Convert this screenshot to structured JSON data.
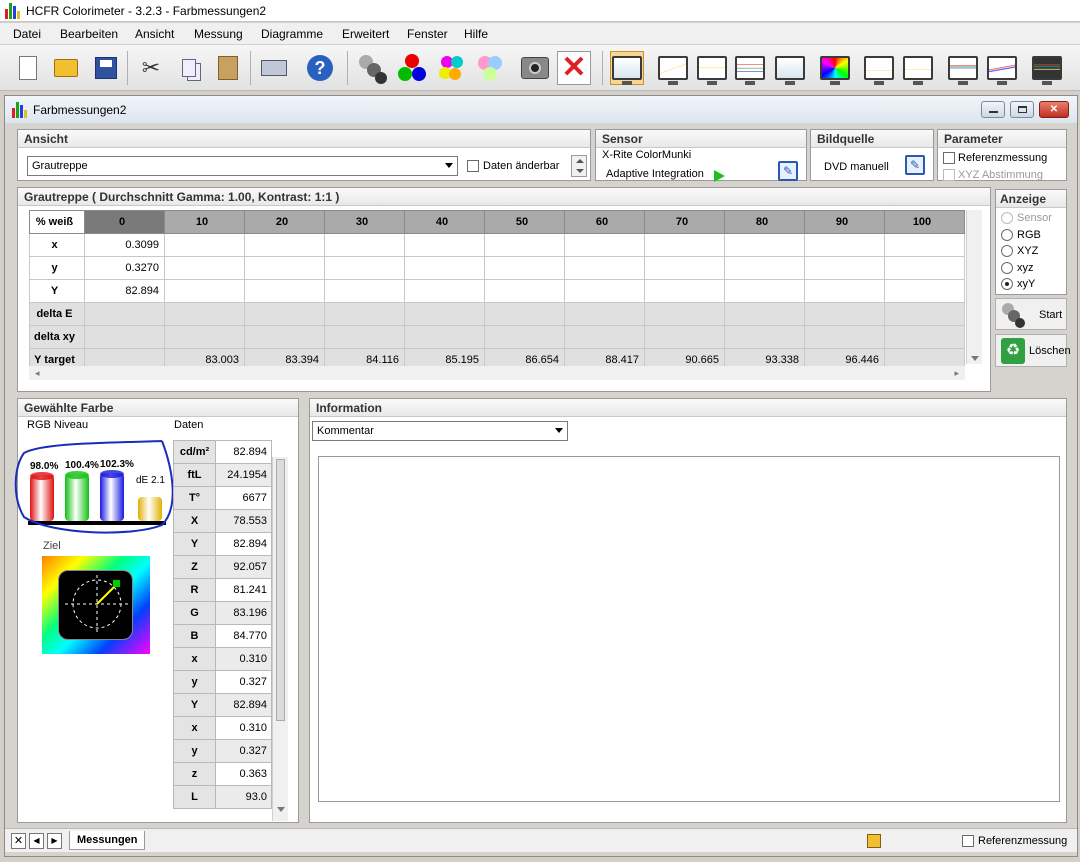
{
  "app": {
    "title": "HCFR Colorimeter - 3.2.3 - Farbmessungen2"
  },
  "menu": [
    "Datei",
    "Bearbeiten",
    "Ansicht",
    "Messung",
    "Diagramme",
    "Erweitert",
    "Fenster",
    "Hilfe"
  ],
  "toolbar_icons": [
    "new-document-icon",
    "open-folder-icon",
    "save-icon",
    "cut-icon",
    "copy-icon",
    "paste-icon",
    "print-icon",
    "help-icon",
    "gray-balls-icon",
    "rgb-balls-icon",
    "colored-balls-icon",
    "pastel-balls-icon",
    "camera-icon",
    "delete-x-icon",
    "monitor-view-icon",
    "gamma-chart-icon",
    "luminance-chart-icon",
    "rgb-levels-chart-icon",
    "white-chart-icon",
    "cie-chart-icon",
    "ntsc-chart-icon",
    "colortemp-chart-icon",
    "rgb-histo-chart-icon",
    "near-black-chart-icon",
    "near-white-chart-icon"
  ],
  "doc": {
    "title": "Farbmessungen2"
  },
  "ansicht": {
    "title": "Ansicht",
    "combo_value": "Grautreppe",
    "checkbox_label": "Daten änderbar"
  },
  "sensor": {
    "title": "Sensor",
    "name": "X-Rite ColorMunki",
    "mode": "Adaptive Integration"
  },
  "bildquelle": {
    "title": "Bildquelle",
    "value": "DVD manuell"
  },
  "parameter": {
    "title": "Parameter",
    "ref": "Referenzmessung",
    "xyz": "XYZ Abstimmung"
  },
  "grid": {
    "title": "Grautreppe ( Durchschnitt Gamma: 1.00, Kontrast: 1:1 )",
    "corner": "% weiß",
    "columns": [
      "0",
      "10",
      "20",
      "30",
      "40",
      "50",
      "60",
      "70",
      "80",
      "90",
      "100"
    ],
    "rows": [
      {
        "label": "x",
        "values": [
          "0.3099",
          "",
          "",
          "",
          "",
          "",
          "",
          "",
          "",
          "",
          ""
        ]
      },
      {
        "label": "y",
        "values": [
          "0.3270",
          "",
          "",
          "",
          "",
          "",
          "",
          "",
          "",
          "",
          ""
        ]
      },
      {
        "label": "Y",
        "values": [
          "82.894",
          "",
          "",
          "",
          "",
          "",
          "",
          "",
          "",
          "",
          ""
        ]
      },
      {
        "label": "delta E",
        "values": [
          "",
          "",
          "",
          "",
          "",
          "",
          "",
          "",
          "",
          "",
          ""
        ]
      },
      {
        "label": "delta xy",
        "values": [
          "",
          "",
          "",
          "",
          "",
          "",
          "",
          "",
          "",
          "",
          ""
        ]
      },
      {
        "label": "Y target",
        "values": [
          "",
          "83.003",
          "83.394",
          "84.116",
          "85.195",
          "86.654",
          "88.417",
          "90.665",
          "93.338",
          "96.446",
          ""
        ]
      }
    ]
  },
  "anzeige": {
    "title": "Anzeige",
    "options": [
      "Sensor",
      "RGB",
      "XYZ",
      "xyz",
      "xyY"
    ],
    "selected": "xyY"
  },
  "buttons": {
    "start": "Start",
    "loeschen": "Löschen"
  },
  "farbe": {
    "title": "Gewählte Farbe",
    "rgb_label": "RGB Niveau",
    "daten_label": "Daten",
    "ziel_label": "Ziel",
    "levels": [
      {
        "label": "98.0%",
        "value": 98.0,
        "color": "#e01010"
      },
      {
        "label": "100.4%",
        "value": 100.4,
        "color": "#10c010"
      },
      {
        "label": "102.3%",
        "value": 102.3,
        "color": "#1818e0"
      }
    ],
    "de_label": "dE 2.1",
    "data": [
      {
        "k": "cd/m²",
        "v": "82.894"
      },
      {
        "k": "ftL",
        "v": "24.1954"
      },
      {
        "k": "T°",
        "v": "6677"
      },
      {
        "k": "X",
        "v": "78.553"
      },
      {
        "k": "Y",
        "v": "82.894"
      },
      {
        "k": "Z",
        "v": "92.057"
      },
      {
        "k": "R",
        "v": "81.241"
      },
      {
        "k": "G",
        "v": "83.196"
      },
      {
        "k": "B",
        "v": "84.770"
      },
      {
        "k": "x",
        "v": "0.310"
      },
      {
        "k": "y",
        "v": "0.327"
      },
      {
        "k": "Y",
        "v": "82.894"
      },
      {
        "k": "x",
        "v": "0.310"
      },
      {
        "k": "y",
        "v": "0.327"
      },
      {
        "k": "z",
        "v": "0.363"
      },
      {
        "k": "L",
        "v": "93.0"
      }
    ]
  },
  "information": {
    "title": "Information",
    "combo_value": "Kommentar"
  },
  "status": {
    "tab": "Messungen",
    "ref": "Referenzmessung"
  }
}
